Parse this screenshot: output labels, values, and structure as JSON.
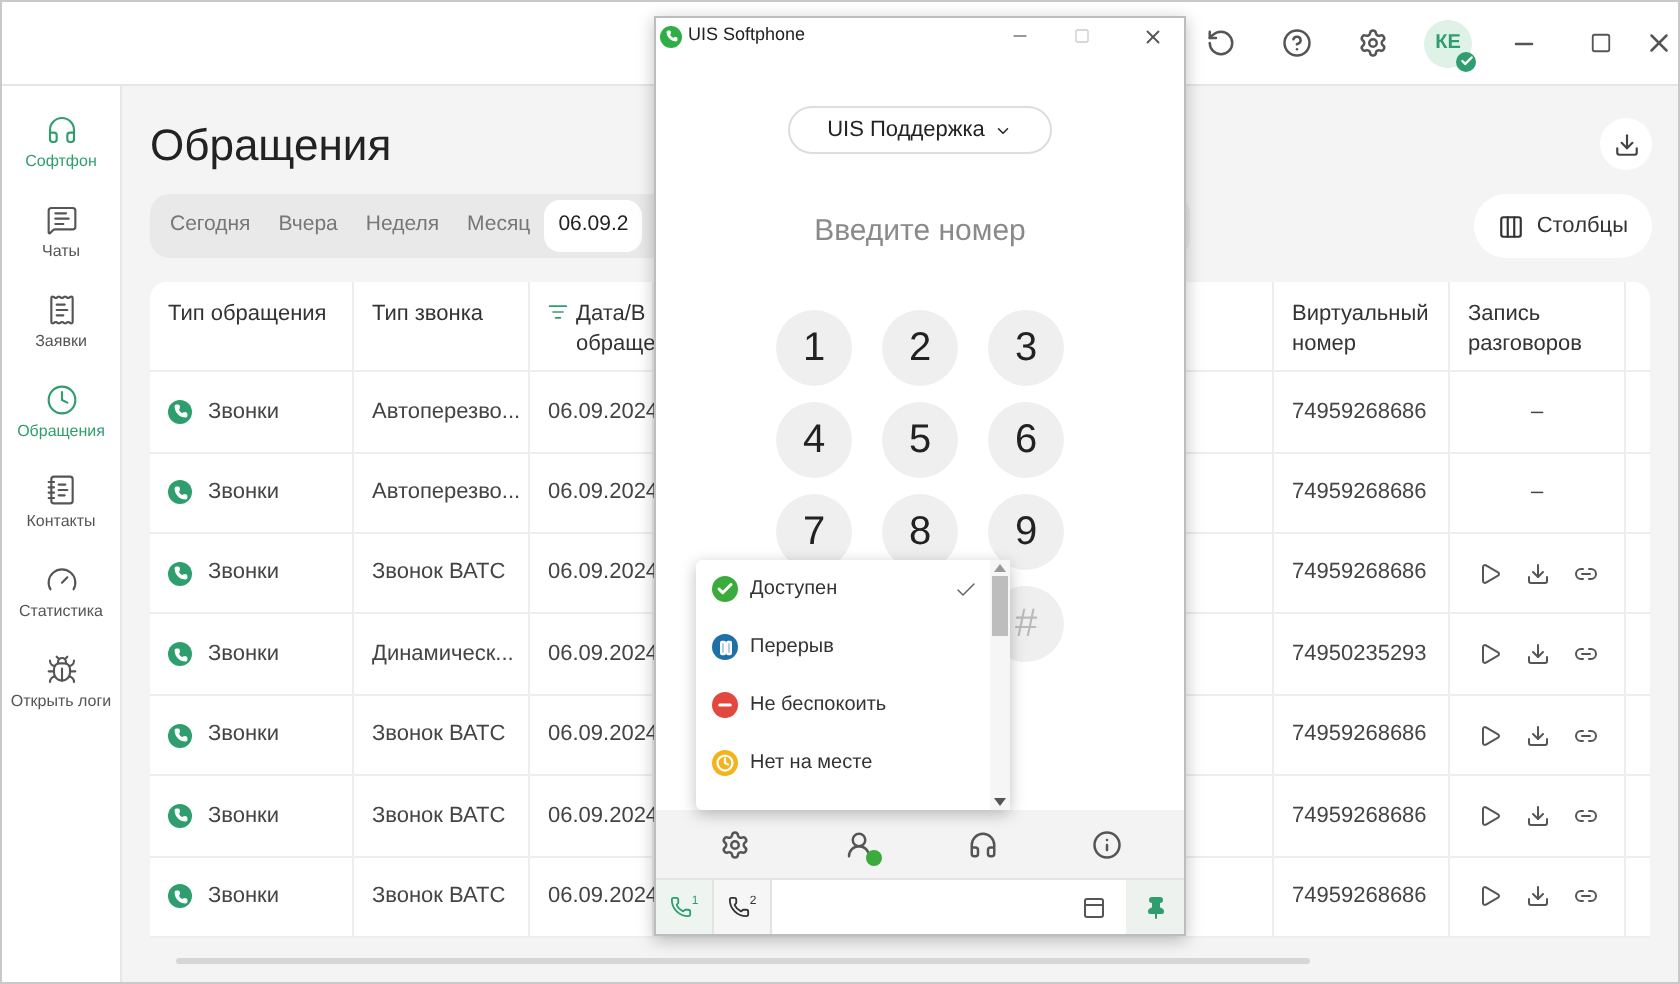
{
  "top_bar": {
    "avatar": "КЕ"
  },
  "sidebar": {
    "items": [
      {
        "kind": "softphone",
        "label": "Софтфон",
        "selected": true
      },
      {
        "kind": "chats",
        "label": "Чаты",
        "selected": false
      },
      {
        "kind": "requests",
        "label": "Заявки",
        "selected": false
      },
      {
        "kind": "history",
        "label": "Обращения",
        "selected": true
      },
      {
        "kind": "contacts",
        "label": "Контакты",
        "selected": false
      },
      {
        "kind": "stats",
        "label": "Статистика",
        "selected": false
      },
      {
        "kind": "logs",
        "label": "Открыть логи",
        "selected": false
      }
    ]
  },
  "page_title": "Обращения",
  "period_tabs": [
    {
      "label": "Сегодня",
      "selected": false
    },
    {
      "label": "Вчера",
      "selected": false
    },
    {
      "label": "Неделя",
      "selected": false
    },
    {
      "label": "Месяц",
      "selected": false
    },
    {
      "label": "06.09.2",
      "selected": true
    }
  ],
  "columns_button": "Столбцы",
  "table": {
    "columns": [
      "Тип обращения",
      "Тип звонка",
      "Дата/В обраще",
      "Виртуальный номер",
      "Запись разговоров"
    ],
    "rows": [
      {
        "type": "Звонки",
        "call_type": "Автоперезво...",
        "date": "06.09.2024",
        "virtual_number": "74959268686",
        "record": {
          "kind": "dash",
          "text": "–"
        }
      },
      {
        "type": "Звонки",
        "call_type": "Автоперезво...",
        "date": "06.09.2024",
        "virtual_number": "74959268686",
        "record": {
          "kind": "dash",
          "text": "–"
        }
      },
      {
        "type": "Звонки",
        "call_type": "Звонок ВАТС",
        "date": "06.09.2024",
        "virtual_number": "74959268686",
        "record": {
          "kind": "actions"
        }
      },
      {
        "type": "Звонки",
        "call_type": "Динамическ...",
        "date": "06.09.2024",
        "virtual_number": "74950235293",
        "record": {
          "kind": "actions"
        }
      },
      {
        "type": "Звонки",
        "call_type": "Звонок ВАТС",
        "date": "06.09.2024",
        "virtual_number": "74959268686",
        "record": {
          "kind": "actions"
        }
      },
      {
        "type": "Звонки",
        "call_type": "Звонок ВАТС",
        "date": "06.09.2024",
        "virtual_number": "74959268686",
        "record": {
          "kind": "actions"
        }
      },
      {
        "type": "Звонки",
        "call_type": "Звонок ВАТС",
        "date": "06.09.2024",
        "virtual_number": "74959268686",
        "record": {
          "kind": "actions"
        }
      }
    ]
  },
  "softphone": {
    "title": "UIS Softphone",
    "account": "UIS Поддержка",
    "number_field": {
      "placeholder": "Введите номер"
    },
    "keys": [
      "1",
      "2",
      "3",
      "4",
      "5",
      "6",
      "7",
      "8",
      "9",
      "#"
    ],
    "status_menu": {
      "items": [
        {
          "label": "Доступен",
          "color": "#3bab3b",
          "kind": "available",
          "selected": true
        },
        {
          "label": "Перерыв",
          "color": "#1f6fa8",
          "kind": "break",
          "selected": false
        },
        {
          "label": "Не беспокоить",
          "color": "#e2483d",
          "kind": "dnd",
          "selected": false
        },
        {
          "label": "Нет на месте",
          "color": "#f2b31b",
          "kind": "away",
          "selected": false
        }
      ]
    },
    "lines": [
      {
        "label": "1",
        "selected": true
      },
      {
        "label": "2",
        "selected": false
      }
    ]
  }
}
